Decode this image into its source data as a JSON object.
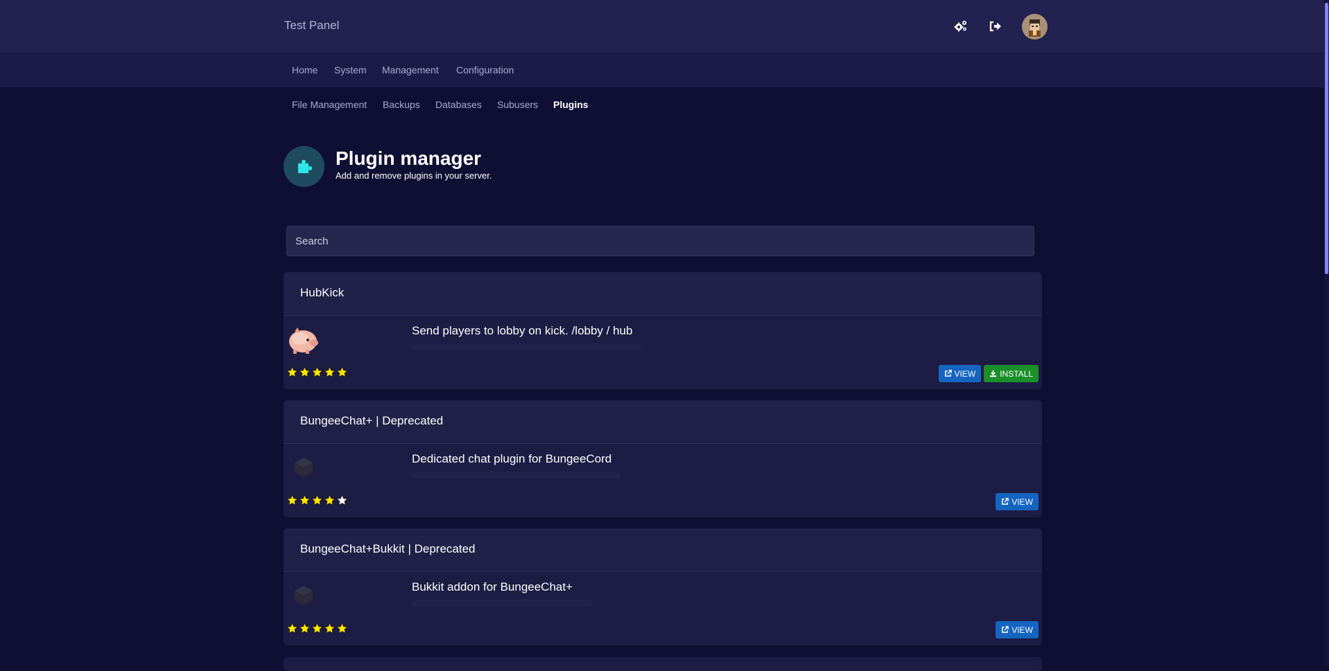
{
  "header": {
    "brand": "Test Panel",
    "icons": [
      "settings-gears-icon",
      "sign-out-icon",
      "user-avatar"
    ]
  },
  "nav_primary": [
    "Home",
    "System",
    "Management",
    "Configuration"
  ],
  "nav_secondary": [
    {
      "label": "File Management",
      "active": false
    },
    {
      "label": "Backups",
      "active": false
    },
    {
      "label": "Databases",
      "active": false
    },
    {
      "label": "Subusers",
      "active": false
    },
    {
      "label": "Plugins",
      "active": true
    }
  ],
  "page": {
    "title": "Plugin manager",
    "subtitle": "Add and remove plugins in your server.",
    "icon": "puzzle-piece-icon"
  },
  "search": {
    "placeholder": "Search",
    "value": ""
  },
  "plugins": [
    {
      "name": "HubKick",
      "description": "Send players to lobby on kick. /lobby / hub",
      "rating": 5,
      "thumb": "pig-icon",
      "buttons": {
        "view": "VIEW",
        "install": "INSTALL"
      }
    },
    {
      "name": "BungeeChat+ | Deprecated",
      "description": "Dedicated chat plugin for BungeeCord",
      "rating": 4,
      "thumb": "cube-icon",
      "buttons": {
        "view": "VIEW"
      }
    },
    {
      "name": "BungeeChat+Bukkit | Deprecated",
      "description": "Bukkit addon for BungeeChat+",
      "rating": 5,
      "thumb": "cube-icon",
      "buttons": {
        "view": "VIEW"
      }
    }
  ],
  "colors": {
    "background": "#0f0f34",
    "topbar": "#222150",
    "card": "#1d1c44",
    "view_button": "#1565c0",
    "install_button": "#1a8f2a",
    "star_filled": "#ffe600",
    "star_empty": "#ffffff",
    "accent_icon": "#2ee6e6"
  }
}
